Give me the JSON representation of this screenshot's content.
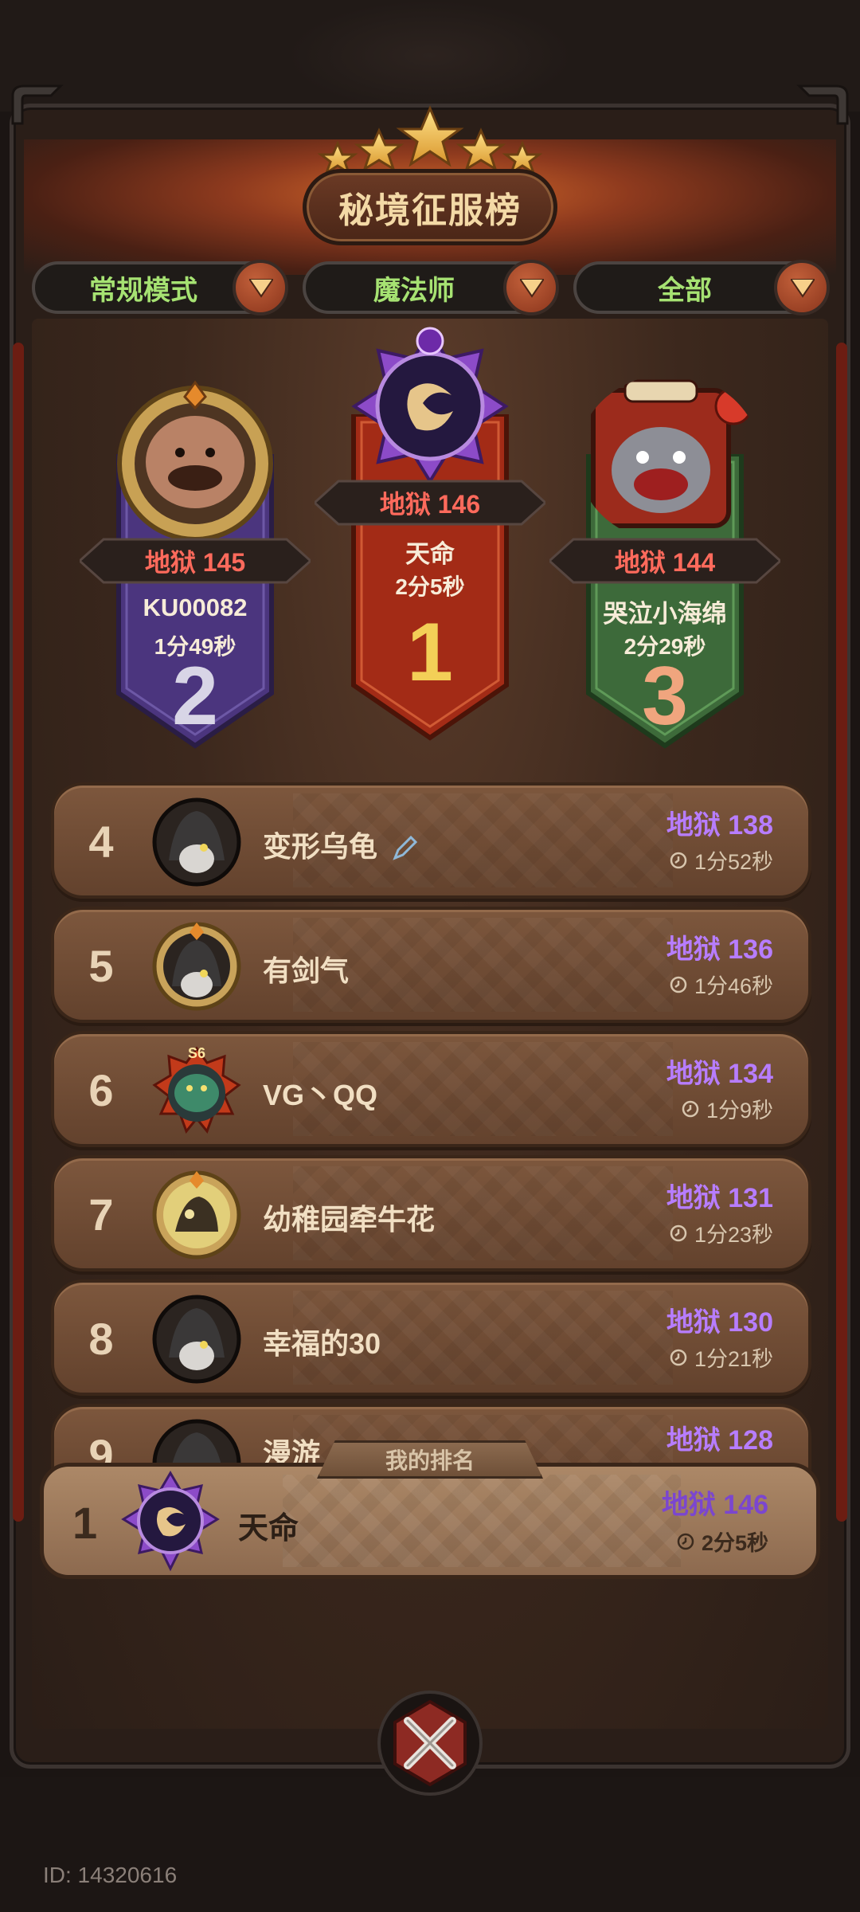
{
  "header": {
    "title": "秘境征服榜"
  },
  "filters": [
    {
      "label": "常规模式"
    },
    {
      "label": "魔法师"
    },
    {
      "label": "全部"
    }
  ],
  "podium": {
    "first": {
      "rank": "1",
      "score": "地狱 146",
      "name": "天命",
      "time": "2分5秒"
    },
    "second": {
      "rank": "2",
      "score": "地狱 145",
      "name": "KU00082",
      "time": "1分49秒"
    },
    "third": {
      "rank": "3",
      "score": "地狱 144",
      "name": "哭泣小海绵",
      "time": "2分29秒"
    }
  },
  "rows": [
    {
      "rank": "4",
      "name": "变形乌龟",
      "score": "地狱 138",
      "time": "1分52秒"
    },
    {
      "rank": "5",
      "name": "有剑气",
      "score": "地狱 136",
      "time": "1分46秒"
    },
    {
      "rank": "6",
      "name": "VG丶QQ",
      "score": "地狱 134",
      "time": "1分9秒",
      "badge": "S6"
    },
    {
      "rank": "7",
      "name": "幼稚园牵牛花",
      "score": "地狱 131",
      "time": "1分23秒"
    },
    {
      "rank": "8",
      "name": "幸福的30",
      "score": "地狱 130",
      "time": "1分21秒"
    },
    {
      "rank": "9",
      "name": "漫游",
      "score": "地狱 128",
      "time": ""
    }
  ],
  "my_rank": {
    "label": "我的排名",
    "rank": "1",
    "name": "天命",
    "score": "地狱 146",
    "time": "2分5秒"
  },
  "footer": {
    "uid": "ID: 14320616"
  },
  "colors": {
    "accent_purple": "#b77dff",
    "filter_green": "#a6e272",
    "score_red": "#ff6a5c"
  }
}
